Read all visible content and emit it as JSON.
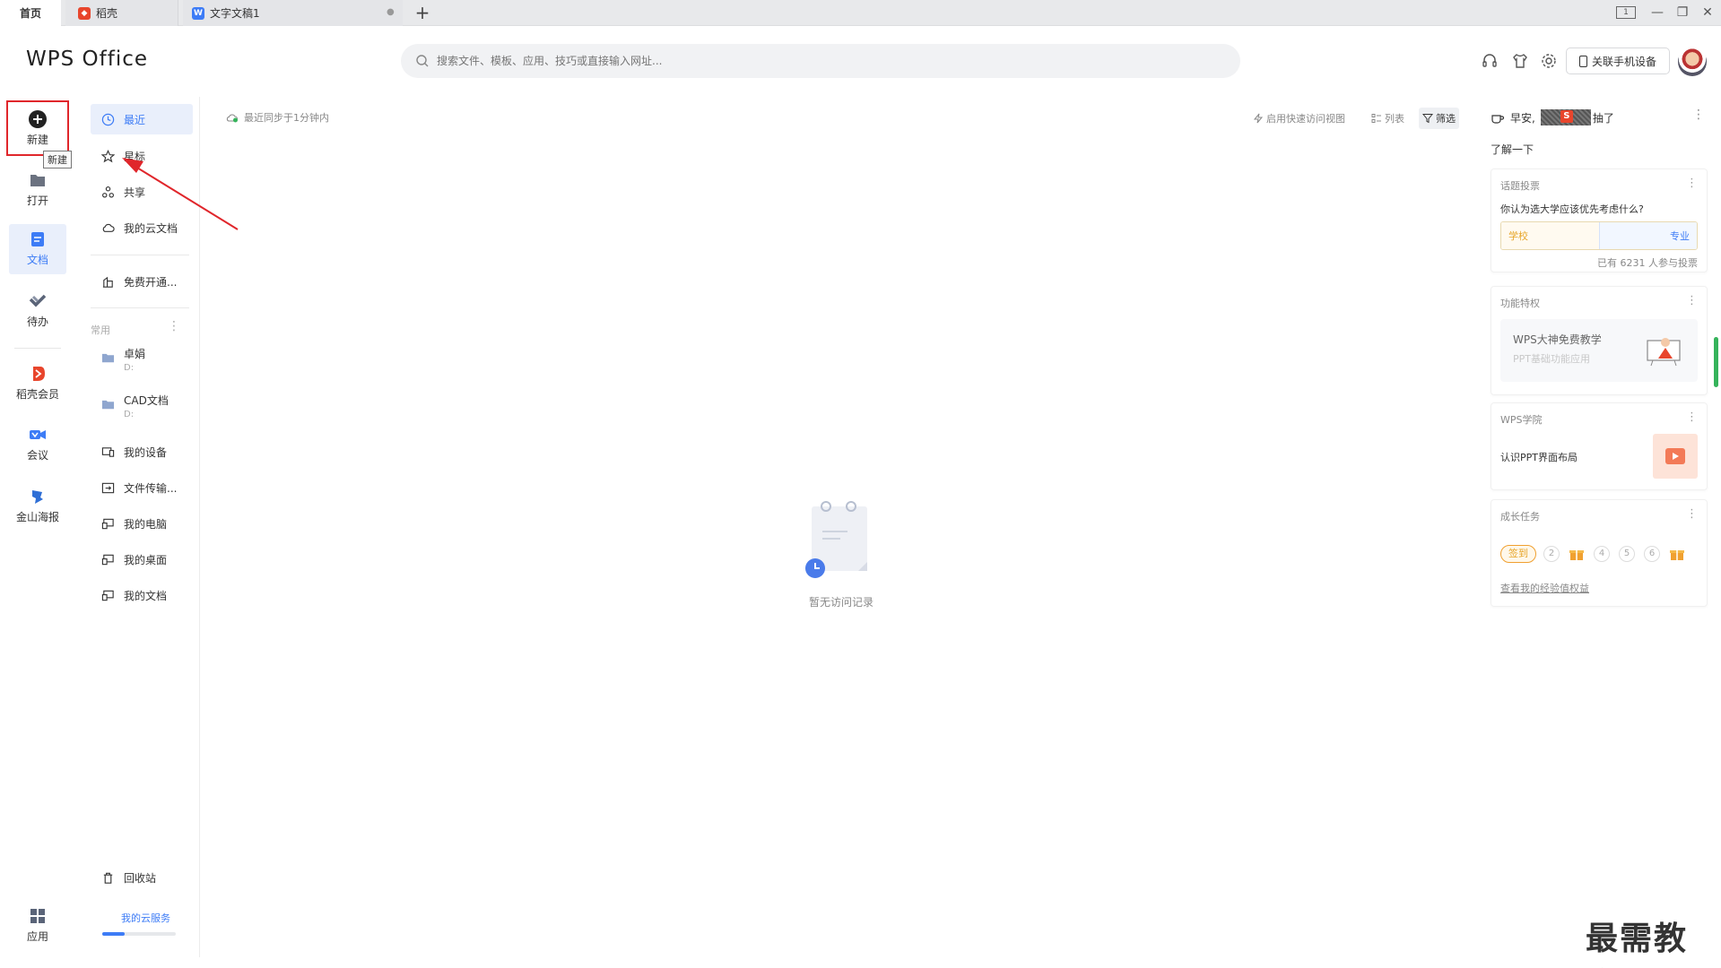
{
  "tabs": {
    "home": "首页",
    "daoke": "稻壳",
    "doc": "文字文稿1",
    "add": "+"
  },
  "window": {
    "minimize": "—",
    "restore": "❐",
    "close": "✕",
    "page_badge": "1"
  },
  "header": {
    "logo": "WPS Office",
    "search_placeholder": "搜索文件、模板、应用、技巧或直接输入网址...",
    "phone_button": "关联手机设备"
  },
  "rail": {
    "new": "新建",
    "new_tooltip": "新建",
    "open": "打开",
    "doc": "文档",
    "todo": "待办",
    "vip": "稻壳会员",
    "meeting": "会议",
    "poster": "金山海报",
    "apps": "应用"
  },
  "nav": {
    "recent": "最近",
    "star": "星标",
    "share": "共享",
    "cloud": "我的云文档",
    "free": "免费开通...",
    "group_title": "常用",
    "group_more": "⋮",
    "desktop_folder": "卓娟",
    "desktop_folder_sub": "D:",
    "cad": "CAD文档",
    "cad_sub": "D:",
    "device": "我的设备",
    "transfer": "文件传输...",
    "pc": "我的电脑",
    "desk": "我的桌面",
    "mydocs": "我的文档",
    "trash": "回收站",
    "cloud_service": "我的云服务",
    "cloud_usage": 0.3
  },
  "main": {
    "sync": "最近同步于1分钟内",
    "quick_view": "启用快速访问视图",
    "list": "列表",
    "filter": "筛选",
    "empty": "暂无访问记录"
  },
  "right": {
    "greet_prefix": "早安,",
    "greet_suffix": "抽了",
    "learn": "了解一下",
    "more": "⋮",
    "vote": {
      "title": "话题投票",
      "question": "你认为选大学应该优先考虑什么?",
      "option_a": "学校",
      "option_b": "专业",
      "count": "已有 6231 人参与投票"
    },
    "privilege": {
      "title": "功能特权",
      "headline": "WPS大神免费教学",
      "subline": "PPT基础功能应用"
    },
    "college": {
      "title": "WPS学院",
      "item": "认识PPT界面布局"
    },
    "growth": {
      "title": "成长任务",
      "sign": "签到",
      "steps": [
        "2",
        "4",
        "5",
        "6"
      ],
      "link": "查看我的经验值权益"
    }
  },
  "watermark": "最需教育",
  "colors": {
    "accent": "#3d7cf6",
    "highlight_box": "#e0262b",
    "arrow": "#e0262b"
  }
}
